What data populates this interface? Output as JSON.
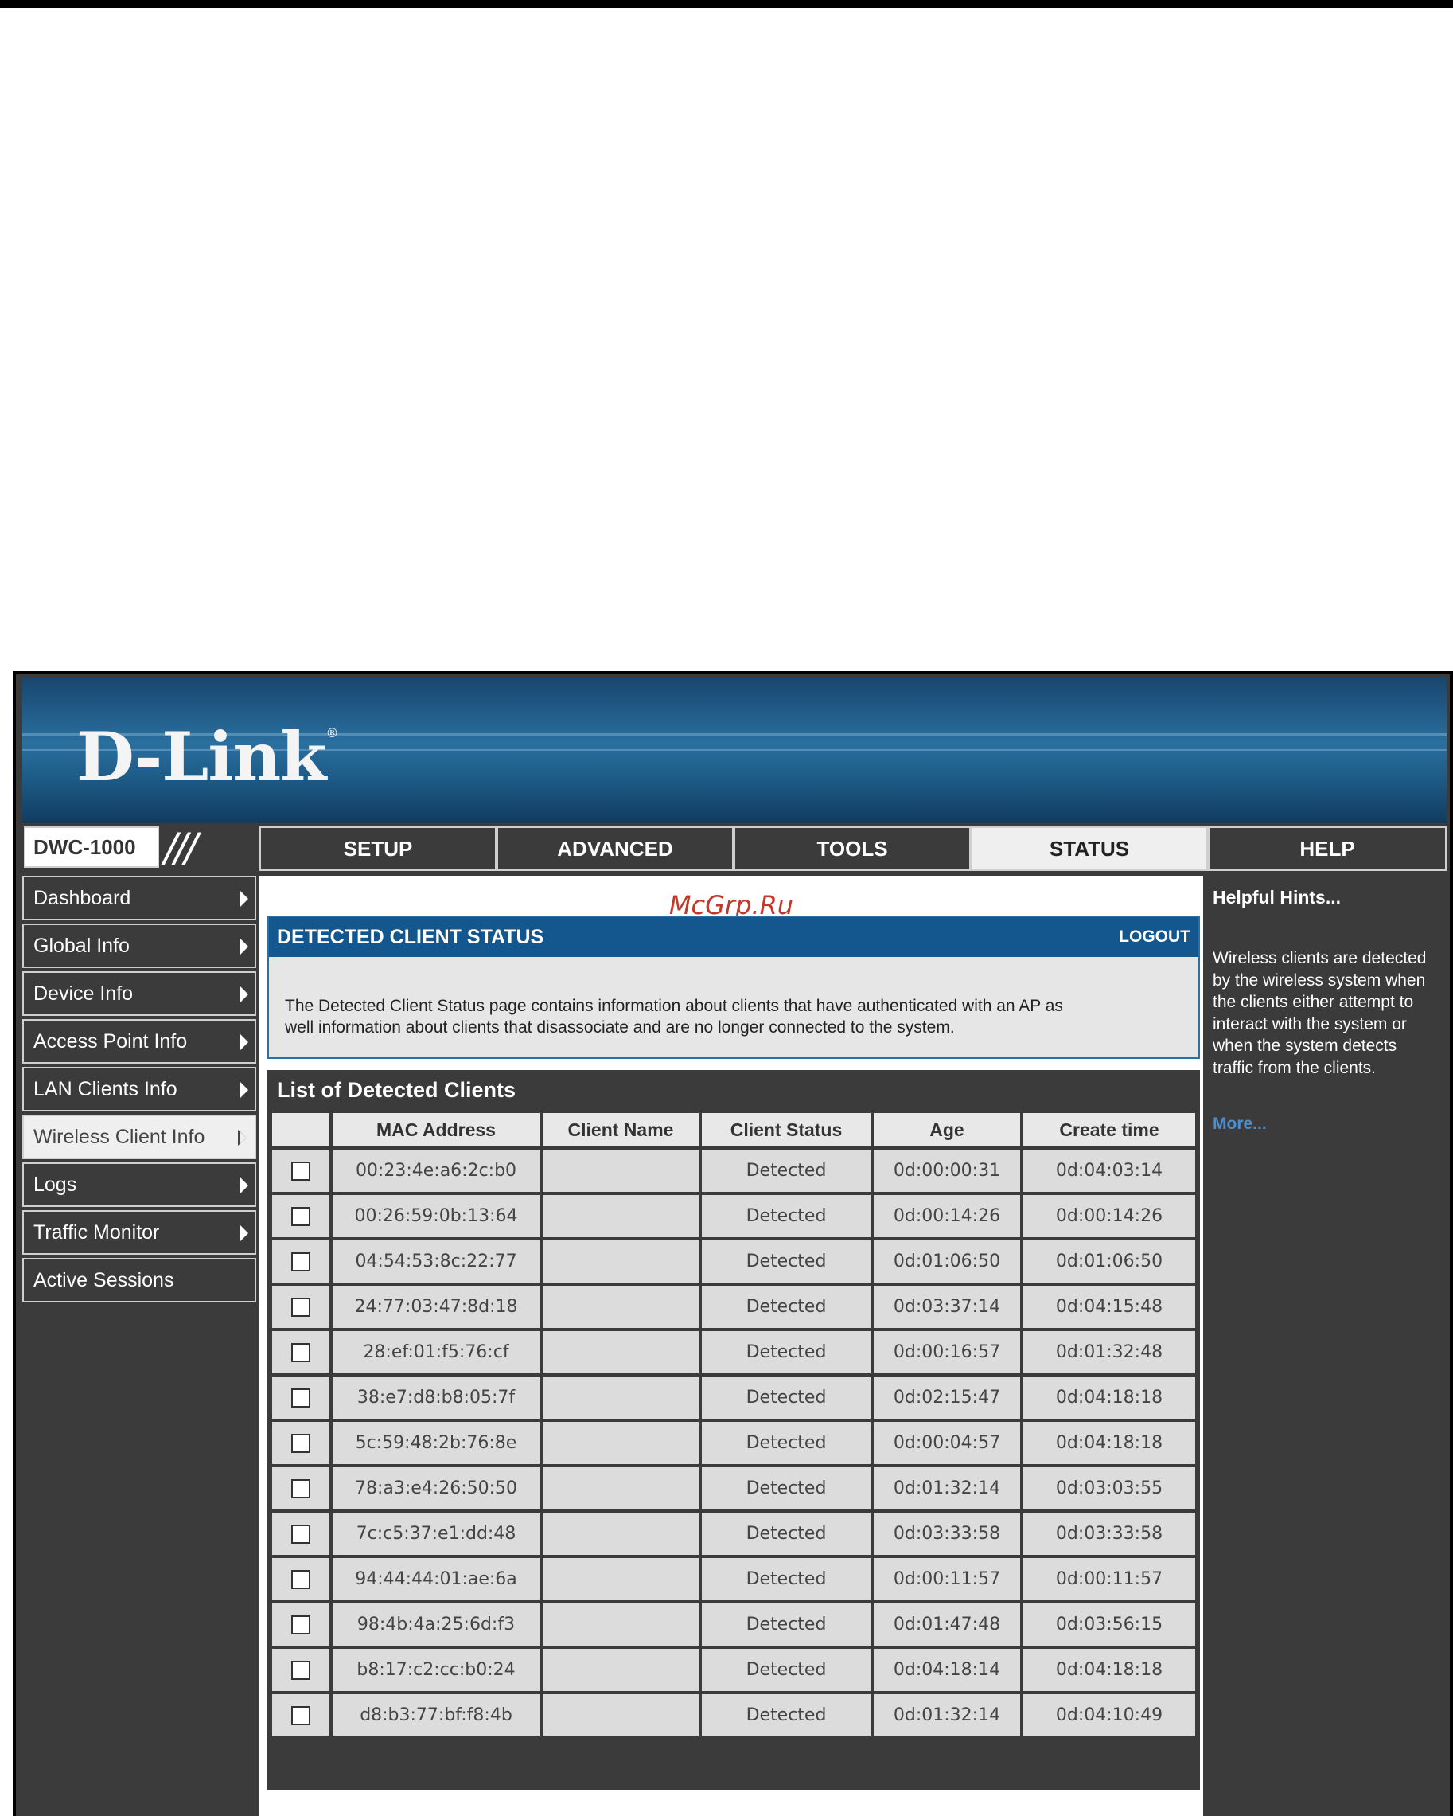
{
  "brand": {
    "logo_text": "D-Link",
    "registered_mark": "®"
  },
  "nav": {
    "model": "DWC-1000",
    "tabs": [
      "SETUP",
      "ADVANCED",
      "TOOLS",
      "STATUS",
      "HELP"
    ],
    "active_tab": "STATUS"
  },
  "sidebar": {
    "items": [
      {
        "label": "Dashboard",
        "has_arrow": true
      },
      {
        "label": "Global Info",
        "has_arrow": true
      },
      {
        "label": "Device Info",
        "has_arrow": true
      },
      {
        "label": "Access Point Info",
        "has_arrow": true
      },
      {
        "label": "LAN Clients Info",
        "has_arrow": true
      },
      {
        "label": "Wireless Client Info",
        "has_arrow": true
      },
      {
        "label": "Logs",
        "has_arrow": true
      },
      {
        "label": "Traffic Monitor",
        "has_arrow": true
      },
      {
        "label": "Active Sessions",
        "has_arrow": false
      }
    ],
    "active_index": 5
  },
  "watermark": "McGrp.Ru",
  "status_section": {
    "title": "DETECTED CLIENT STATUS",
    "logout": "LOGOUT",
    "description_line1": "The Detected Client Status page contains information about clients that have authenticated with an AP as",
    "description_line2": "well information about clients that disassociate and are no longer connected to the system."
  },
  "clients_table": {
    "title": "List of Detected Clients",
    "columns": [
      "",
      "MAC Address",
      "Client Name",
      "Client Status",
      "Age",
      "Create time"
    ],
    "rows": [
      [
        "00:23:4e:a6:2c:b0",
        "",
        "Detected",
        "0d:00:00:31",
        "0d:04:03:14"
      ],
      [
        "00:26:59:0b:13:64",
        "",
        "Detected",
        "0d:00:14:26",
        "0d:00:14:26"
      ],
      [
        "04:54:53:8c:22:77",
        "",
        "Detected",
        "0d:01:06:50",
        "0d:01:06:50"
      ],
      [
        "24:77:03:47:8d:18",
        "",
        "Detected",
        "0d:03:37:14",
        "0d:04:15:48"
      ],
      [
        "28:ef:01:f5:76:cf",
        "",
        "Detected",
        "0d:00:16:57",
        "0d:01:32:48"
      ],
      [
        "38:e7:d8:b8:05:7f",
        "",
        "Detected",
        "0d:02:15:47",
        "0d:04:18:18"
      ],
      [
        "5c:59:48:2b:76:8e",
        "",
        "Detected",
        "0d:00:04:57",
        "0d:04:18:18"
      ],
      [
        "78:a3:e4:26:50:50",
        "",
        "Detected",
        "0d:01:32:14",
        "0d:03:03:55"
      ],
      [
        "7c:c5:37:e1:dd:48",
        "",
        "Detected",
        "0d:03:33:58",
        "0d:03:33:58"
      ],
      [
        "94:44:44:01:ae:6a",
        "",
        "Detected",
        "0d:00:11:57",
        "0d:00:11:57"
      ],
      [
        "98:4b:4a:25:6d:f3",
        "",
        "Detected",
        "0d:01:47:48",
        "0d:03:56:15"
      ],
      [
        "b8:17:c2:cc:b0:24",
        "",
        "Detected",
        "0d:04:18:14",
        "0d:04:18:18"
      ],
      [
        "d8:b3:77:bf:f8:4b",
        "",
        "Detected",
        "0d:01:32:14",
        "0d:04:10:49"
      ]
    ]
  },
  "help": {
    "title": "Helpful Hints...",
    "text": "Wireless clients are detected by the wireless system when the clients either attempt to interact with the system or when the system detects traffic from the clients.",
    "more": "More..."
  },
  "colors": {
    "banner": "#1d5a86",
    "panel_dark": "#3b3b3b",
    "status_header": "#14578e",
    "link": "#4a8fd0",
    "watermark": "#c0392b"
  }
}
